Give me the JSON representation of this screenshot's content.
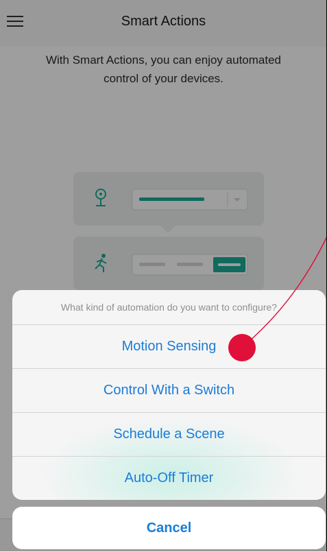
{
  "header": {
    "title": "Smart Actions",
    "menu_icon": "hamburger-menu-icon"
  },
  "intro": {
    "text": "With Smart Actions, you can enjoy automated control of your devices."
  },
  "illustration": {
    "camera_icon": "camera-icon",
    "motion_icon": "running-person-icon",
    "accent_color": "#1aab96"
  },
  "action_sheet": {
    "header": "What kind of automation do you want to configure?",
    "options": [
      {
        "label": "Motion Sensing"
      },
      {
        "label": "Control With a Switch"
      },
      {
        "label": "Schedule a Scene"
      },
      {
        "label": "Auto-Off Timer"
      }
    ],
    "cancel_label": "Cancel",
    "option_color": "#1b7cd6"
  },
  "annotation": {
    "marker_color": "#e0103a"
  }
}
